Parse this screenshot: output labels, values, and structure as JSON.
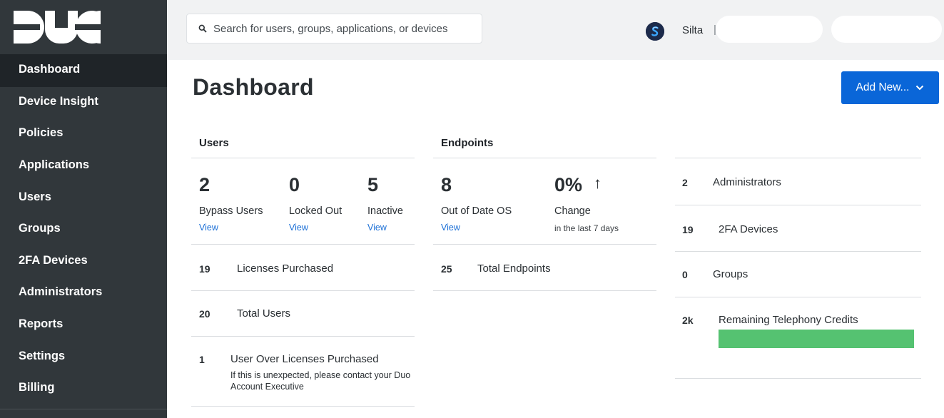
{
  "brand": {
    "logo_text": "DUO",
    "accent": "#0a66d8",
    "sidebar_bg": "#31373b",
    "success": "#55c271"
  },
  "sidebar": {
    "items": [
      {
        "label": "Dashboard",
        "active": true
      },
      {
        "label": "Device Insight"
      },
      {
        "label": "Policies"
      },
      {
        "label": "Applications"
      },
      {
        "label": "Users"
      },
      {
        "label": "Groups"
      },
      {
        "label": "2FA Devices"
      },
      {
        "label": "Administrators"
      },
      {
        "label": "Reports"
      },
      {
        "label": "Settings"
      },
      {
        "label": "Billing"
      }
    ]
  },
  "topbar": {
    "search_placeholder": "Search for users, groups, applications, or devices",
    "search_icon": "search-icon",
    "account_initial": "S",
    "account_name": "Silta",
    "separator": "|"
  },
  "page": {
    "title": "Dashboard",
    "add_new_label": "Add New...",
    "add_new_icon": "chevron-down-icon"
  },
  "users": {
    "header": "Users",
    "stats": [
      {
        "value": "2",
        "label": "Bypass Users",
        "link": "View"
      },
      {
        "value": "0",
        "label": "Locked Out",
        "link": "View"
      },
      {
        "value": "5",
        "label": "Inactive",
        "link": "View"
      }
    ],
    "rows": [
      {
        "num": "19",
        "label": "Licenses Purchased"
      },
      {
        "num": "20",
        "label": "Total Users"
      },
      {
        "num": "1",
        "label": "User Over Licenses Purchased",
        "note": "If this is unexpected, please contact your Duo Account Executive"
      }
    ]
  },
  "endpoints": {
    "header": "Endpoints",
    "stats": [
      {
        "value": "8",
        "label": "Out of Date OS",
        "link": "View"
      },
      {
        "value": "0%",
        "arrow": "↑",
        "label": "Change",
        "note": "in the last 7 days"
      }
    ],
    "rows": [
      {
        "num": "25",
        "label": "Total Endpoints"
      }
    ]
  },
  "summary": {
    "rows": [
      {
        "num": "2",
        "label": "Administrators"
      },
      {
        "num": "19",
        "label": "2FA Devices"
      },
      {
        "num": "0",
        "label": "Groups"
      },
      {
        "num": "2k",
        "label": "Remaining Telephony Credits",
        "credit_fraction": 1.0
      }
    ]
  }
}
